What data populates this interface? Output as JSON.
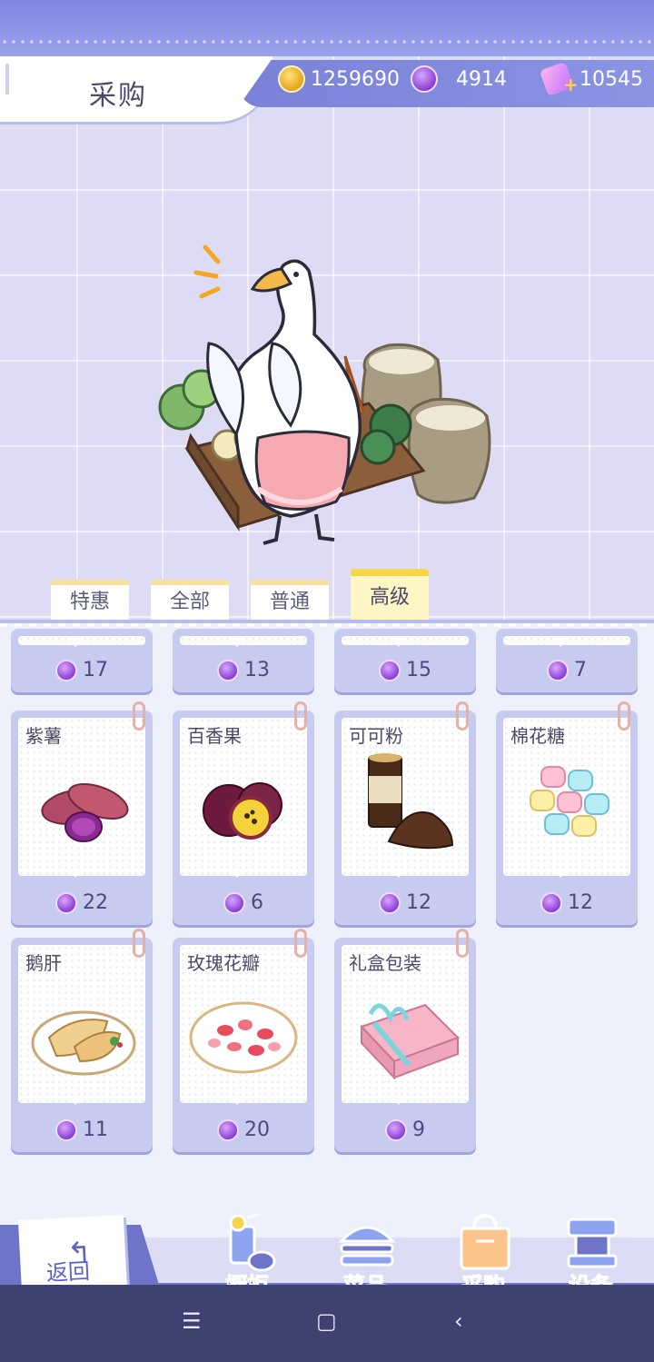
{
  "header": {
    "title": "采购",
    "gold": "1259690",
    "gems": "4914",
    "tickets": "10545"
  },
  "tabs": [
    {
      "label": "特惠",
      "active": false
    },
    {
      "label": "全部",
      "active": false
    },
    {
      "label": "普通",
      "active": false
    },
    {
      "label": "高级",
      "active": true
    }
  ],
  "partial_row_prices": [
    "17",
    "13",
    "15",
    "7"
  ],
  "items": [
    {
      "name": "紫薯",
      "price": "22"
    },
    {
      "name": "百香果",
      "price": "6"
    },
    {
      "name": "可可粉",
      "price": "12"
    },
    {
      "name": "棉花糖",
      "price": "12"
    },
    {
      "name": "鹅肝",
      "price": "11"
    },
    {
      "name": "玫瑰花瓣",
      "price": "20"
    },
    {
      "name": "礼盒包装",
      "price": "9"
    }
  ],
  "bottom_nav": {
    "back": "返回",
    "items": [
      {
        "label": "橱柜",
        "icon": "drink-icon"
      },
      {
        "label": "菜品",
        "icon": "burger-icon"
      },
      {
        "label": "采购",
        "icon": "shopping-bag-icon",
        "active": true
      },
      {
        "label": "设备",
        "icon": "coffee-machine-icon"
      }
    ]
  },
  "colors": {
    "accent": "#6e74c8",
    "panel": "#eef0fb",
    "tab_active": "#fff6c6"
  }
}
